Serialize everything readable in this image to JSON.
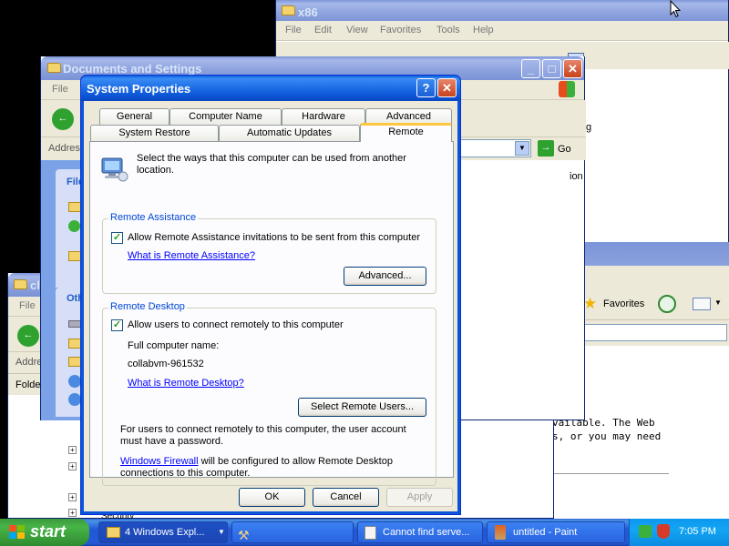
{
  "background_windows": {
    "x86": {
      "title": "x86",
      "menu": [
        "File",
        "Edit",
        "View",
        "Favorites",
        "Tools",
        "Help"
      ]
    },
    "docs": {
      "title": "Documents and Settings",
      "menu_file": "File",
      "address_label": "Addres",
      "file_pane_label": "File",
      "other_pane_label": "Oth",
      "go_label": "Go",
      "partial_text_g": "g",
      "partial_text_ion": "ion"
    },
    "cl": {
      "title": "cl",
      "menu_file": "File",
      "address_label": "Addre",
      "folders_label": "Folder",
      "security_label": "Security"
    },
    "right": {
      "favorites_label": "Favorites",
      "text_line_1": "vailable. The Web",
      "text_line_2": "s, or you may need"
    }
  },
  "dialog": {
    "title": "System Properties",
    "help_glyph": "?",
    "close_glyph": "✕",
    "tabs_top": [
      "General",
      "Computer Name",
      "Hardware",
      "Advanced"
    ],
    "tabs_bottom": [
      "System Restore",
      "Automatic Updates",
      "Remote"
    ],
    "active_tab": "Remote",
    "intro_text": "Select the ways that this computer can be used from another location.",
    "remote_assistance": {
      "title": "Remote Assistance",
      "checkbox_label": "Allow Remote Assistance invitations to be sent from this computer",
      "checked": true,
      "help_link": "What is Remote Assistance?",
      "advanced_button": "Advanced..."
    },
    "remote_desktop": {
      "title": "Remote Desktop",
      "checkbox_label": "Allow users to connect remotely to this computer",
      "checked": true,
      "full_name_label": "Full computer name:",
      "full_name_value": "collabvm-961532",
      "help_link": "What is Remote Desktop?",
      "select_users_button": "Select Remote Users...",
      "note_text": "For users to connect remotely to this computer, the user account must have a password.",
      "firewall_link": "Windows Firewall",
      "firewall_text": " will be configured to allow Remote Desktop connections to this computer."
    },
    "buttons": {
      "ok": "OK",
      "cancel": "Cancel",
      "apply": "Apply"
    }
  },
  "taskbar": {
    "start_label": "start",
    "items": [
      {
        "label": "4 Windows Expl..."
      },
      {
        "label": "Cannot find serve..."
      },
      {
        "label": "untitled - Paint"
      }
    ],
    "clock": "7:05 PM"
  },
  "colors": {
    "titlebar_active": "#0c55d6",
    "dialog_face": "#ece9d8",
    "link": "#0000ff",
    "group_title": "#0046d5",
    "taskbar": "#2459d6",
    "start_button": "#3c9a3c"
  }
}
